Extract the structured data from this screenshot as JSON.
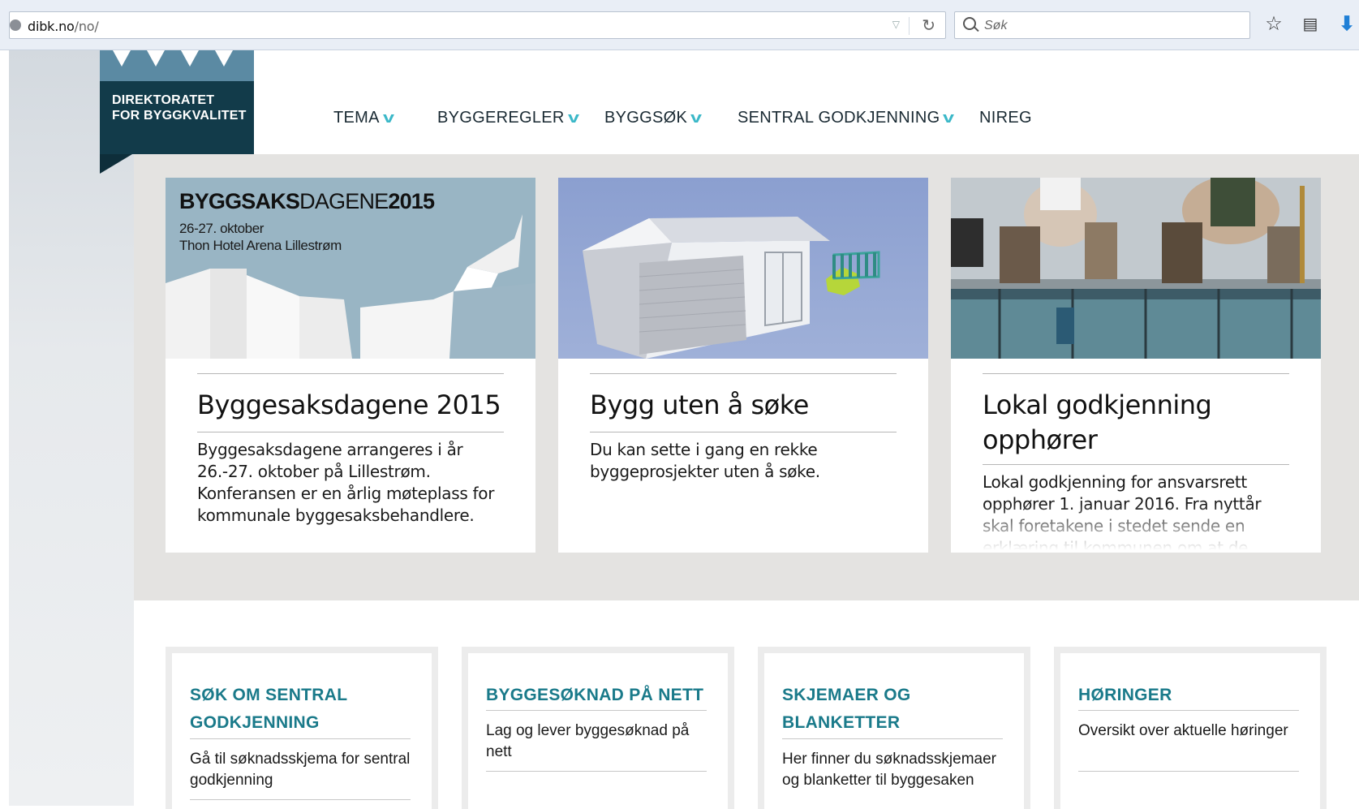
{
  "browser": {
    "url_host": "dibk.no",
    "url_path": "/no/",
    "search_placeholder": "Søk"
  },
  "logo": {
    "line1": "DIREKTORATET",
    "line2": "FOR BYGGKVALITET"
  },
  "nav": {
    "items": [
      {
        "label": "TEMA",
        "has_dropdown": true
      },
      {
        "label": "BYGGEREGLER",
        "has_dropdown": true
      },
      {
        "label": "BYGGSØK",
        "has_dropdown": true
      },
      {
        "label": "SENTRAL GODKJENNING",
        "has_dropdown": true
      },
      {
        "label": "NIREG",
        "has_dropdown": false
      }
    ]
  },
  "features": [
    {
      "banner_bold": "BYGGSAKS",
      "banner_light": "DAGENE",
      "banner_year": "2015",
      "banner_date": "26-27. oktober",
      "banner_place": "Thon Hotel Arena Lillestrøm",
      "title": "Byggesaksdagene 2015",
      "text": "Byggesaksdagene arrangeres i år 26.-27. oktober på Lillestrøm. Konferansen er en årlig møteplass for kommunale byggesaksbehandlere."
    },
    {
      "title": "Bygg uten å søke",
      "text": "Du kan sette i gang en rekke byggeprosjekter uten å søke."
    },
    {
      "title": "Lokal godkjenning opphører",
      "text": "Lokal godkjenning for ansvarsrett opphører 1. januar 2016. Fra nyttår skal foretakene i stedet sende en erklæring til kommunen om at de"
    }
  ],
  "links": [
    {
      "title": "SØK OM SENTRAL GODKJENNING",
      "text": "Gå til søknadsskjema for sentral godkjenning"
    },
    {
      "title": "BYGGESØKNAD PÅ NETT",
      "text": "Lag og lever byggesøknad på nett"
    },
    {
      "title": "SKJEMAER OG BLANKETTER",
      "text": "Her finner du søknadsskjemaer og blanketter til byggesaken"
    },
    {
      "title": "HØRINGER",
      "text": "Oversikt over aktuelle høringer"
    }
  ],
  "colors": {
    "accent_teal": "#1a7a8a",
    "chevron": "#3bb8c8",
    "logo_dark": "#123b4a",
    "band_gray": "#e4e3e1"
  }
}
